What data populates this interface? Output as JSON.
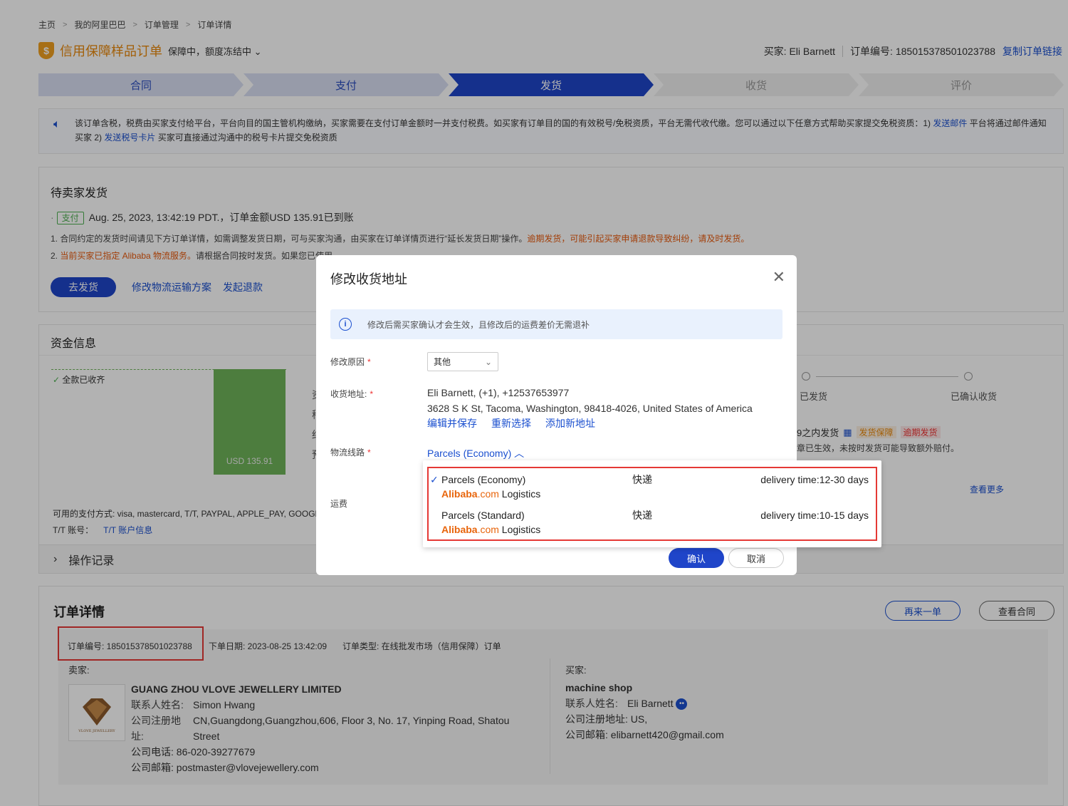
{
  "breadcrumb": [
    "主页",
    "我的阿里巴巴",
    "订单管理",
    "订单详情"
  ],
  "header": {
    "title": "信用保障样品订单",
    "status": "保障中，额度冻结中",
    "buyer": "买家: Eli Barnett",
    "order_no": "订单编号: 185015378501023788",
    "copy_link": "复制订单链接"
  },
  "steps": [
    "合同",
    "支付",
    "发货",
    "收货",
    "评价"
  ],
  "notice": {
    "text1": "该订单含税，税费由买家支付给平台，平台向目的国主管机构缴纳，买家需要在支付订单金额时一并支付税费。如买家有订单目的国的有效税号/免税资质，平台无需代收代缴。您可以通过以下任意方式帮助买家提交免税资质：1)",
    "link1": "发送邮件",
    "text2": "平台将通过邮件通知买家 2)",
    "link2": "发送税号卡片",
    "text3": "买家可直接通过沟通中的税号卡片提交免税资质"
  },
  "pending": {
    "title": "待卖家发货",
    "pay_tag": "支付",
    "pay_text": "Aug. 25, 2023, 13:42:19 PDT.，订单金额USD 135.91已到账",
    "note1": "1. 合同约定的发货时间请见下方订单详情，如需调整发货日期，可与买家沟通，由买家在订单详情页进行“延长发货日期”操作。",
    "note1_warn": "逾期发货，可能引起买家申请退款导致纠纷，请及时发货。",
    "note2_warn": "当前买家已指定 Alibaba 物流服务。",
    "note2": "请根据合同按时发货。如果您已使用...",
    "ship_btn": "去发货",
    "modify_link": "修改物流运输方案",
    "refund_link": "发起退款"
  },
  "funds": {
    "title": "资金信息",
    "full_received": "全款已收齐",
    "bar_label": "USD 135.91",
    "side_letters": [
      "资",
      "稍",
      "结",
      "预"
    ],
    "shipped": "已发货",
    "confirmed": "已确认收货",
    "ship_within": "9之内发货",
    "tag1": "发货保障",
    "tag2": "逾期发货",
    "guarantee_note": "章已生效，未按时发货可能导致额外赔付。",
    "more": "查看更多",
    "payment_methods": "可用的支付方式: visa, mastercard, T/T, PAYPAL, APPLE_PAY, GOOGL",
    "tt_label": "T/T 账号：",
    "tt_link": "T/T 账户信息",
    "ops": "操作记录"
  },
  "modal": {
    "title": "修改收货地址",
    "info": "修改后需买家确认才会生效，且修改后的运费差价无需退补",
    "reason_label": "修改原因",
    "reason_value": "其他",
    "addr_label": "收货地址:",
    "addr_line1": "Eli Barnett, (+1), +12537653977",
    "addr_line2": "3628 S K St, Tacoma, Washington, 98418-4026, United States of America",
    "edit_save": "编辑并保存",
    "reselect": "重新选择",
    "add_new": "添加新地址",
    "route_label": "物流线路",
    "route_value": "Parcels (Economy)",
    "fee_label": "运费",
    "confirm": "确认",
    "cancel": "取消"
  },
  "dropdown": [
    {
      "name": "Parcels (Economy)",
      "type": "快递",
      "time": "delivery time:12-30 days",
      "brand_a": "Alibaba",
      "brand_b": ".com",
      "brand_c": " Logistics"
    },
    {
      "name": "Parcels (Standard)",
      "type": "快递",
      "time": "delivery time:10-15 days",
      "brand_a": "Alibaba",
      "brand_b": ".com",
      "brand_c": " Logistics"
    }
  ],
  "order": {
    "title": "订单详情",
    "reorder": "再来一单",
    "view_contract": "查看合同",
    "order_no": "订单编号: 185015378501023788",
    "order_date": "下单日期: 2023-08-25 13:42:09",
    "order_type": "订单类型: 在线批发市场（信用保障）订单",
    "seller_label": "卖家:",
    "seller_name": "GUANG ZHOU VLOVE JEWELLERY LIMITED",
    "contact_k": "联系人姓名:",
    "contact_v": "Simon Hwang",
    "reg_k": "公司注册地址:",
    "reg_v": "CN,Guangdong,Guangzhou,606, Floor 3, No. 17, Yinping Road, Shatou Street",
    "phone": "公司电话: 86-020-39277679",
    "email": "公司邮箱: postmaster@vlovejewellery.com",
    "logo_text": "VLOVE JEWELLERY",
    "buyer_label": "买家:",
    "buyer_company": "machine shop",
    "buyer_contact_k": "联系人姓名:",
    "buyer_contact_v": "Eli Barnett",
    "buyer_reg": "公司注册地址: US,",
    "buyer_email": "公司邮箱: elibarnett420@gmail.com"
  }
}
